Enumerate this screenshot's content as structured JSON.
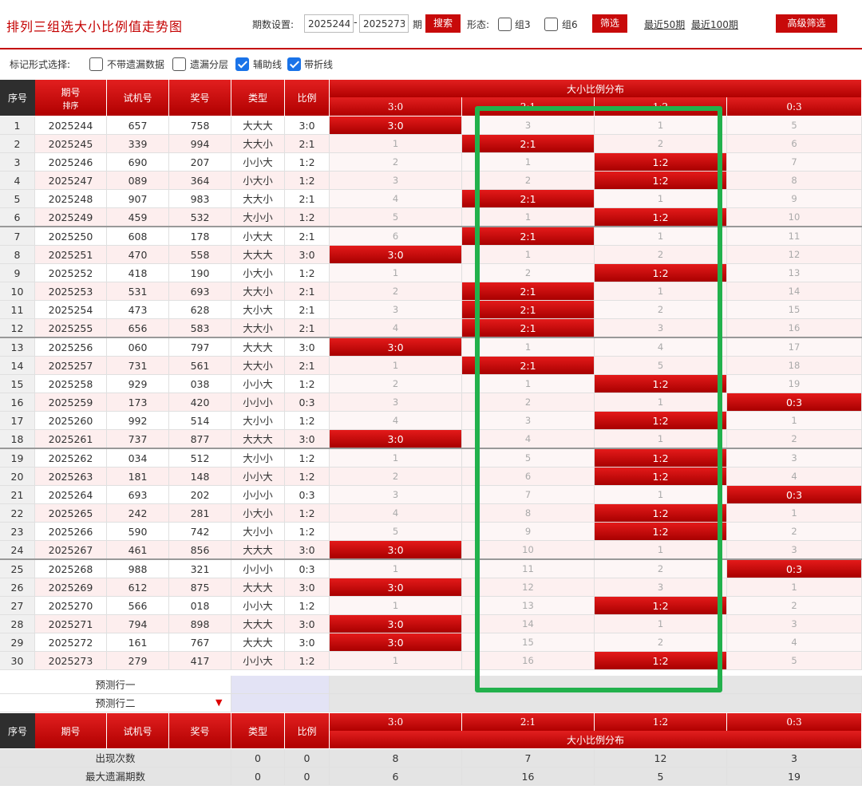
{
  "header": {
    "title": "排列三组选大小比例值走势图",
    "period_label": "期数设置:",
    "period_from": "2025244",
    "period_to": "2025273",
    "period_unit": "期",
    "search_label": "搜索",
    "form_label": "形态:",
    "zu3_label": "组3",
    "zu6_label": "组6",
    "filter_label": "筛选",
    "recent50": "最近50期",
    "recent100": "最近100期",
    "advanced_label": "高级筛选"
  },
  "markbar": {
    "label": "标记形式选择:",
    "opt1": "不带遗漏数据",
    "opt2": "遗漏分层",
    "opt3": "辅助线",
    "opt4": "带折线"
  },
  "table_headers": {
    "seq": "序号",
    "period": "期号",
    "sort": "排序",
    "trial": "试机号",
    "prize": "奖号",
    "type": "类型",
    "ratio": "比例",
    "dist": "大小比例分布",
    "cols": [
      "3:0",
      "2:1",
      "1:2",
      "0:3"
    ]
  },
  "rows": [
    {
      "seq": "1",
      "period": "2025244",
      "trial": "657",
      "prize": "758",
      "type": "大大大",
      "ratio": "3:0",
      "hit": 0,
      "miss": [
        "3:0",
        "3",
        "1",
        "5"
      ]
    },
    {
      "seq": "2",
      "period": "2025245",
      "trial": "339",
      "prize": "994",
      "type": "大大小",
      "ratio": "2:1",
      "hit": 1,
      "miss": [
        "1",
        "2:1",
        "2",
        "6"
      ]
    },
    {
      "seq": "3",
      "period": "2025246",
      "trial": "690",
      "prize": "207",
      "type": "小小大",
      "ratio": "1:2",
      "hit": 2,
      "miss": [
        "2",
        "1",
        "1:2",
        "7"
      ]
    },
    {
      "seq": "4",
      "period": "2025247",
      "trial": "089",
      "prize": "364",
      "type": "小大小",
      "ratio": "1:2",
      "hit": 2,
      "miss": [
        "3",
        "2",
        "1:2",
        "8"
      ]
    },
    {
      "seq": "5",
      "period": "2025248",
      "trial": "907",
      "prize": "983",
      "type": "大大小",
      "ratio": "2:1",
      "hit": 1,
      "miss": [
        "4",
        "2:1",
        "1",
        "9"
      ]
    },
    {
      "seq": "6",
      "period": "2025249",
      "trial": "459",
      "prize": "532",
      "type": "大小小",
      "ratio": "1:2",
      "hit": 2,
      "miss": [
        "5",
        "1",
        "1:2",
        "10"
      ]
    },
    {
      "seq": "7",
      "period": "2025250",
      "trial": "608",
      "prize": "178",
      "type": "小大大",
      "ratio": "2:1",
      "hit": 1,
      "miss": [
        "6",
        "2:1",
        "1",
        "11"
      ]
    },
    {
      "seq": "8",
      "period": "2025251",
      "trial": "470",
      "prize": "558",
      "type": "大大大",
      "ratio": "3:0",
      "hit": 0,
      "miss": [
        "3:0",
        "1",
        "2",
        "12"
      ]
    },
    {
      "seq": "9",
      "period": "2025252",
      "trial": "418",
      "prize": "190",
      "type": "小大小",
      "ratio": "1:2",
      "hit": 2,
      "miss": [
        "1",
        "2",
        "1:2",
        "13"
      ]
    },
    {
      "seq": "10",
      "period": "2025253",
      "trial": "531",
      "prize": "693",
      "type": "大大小",
      "ratio": "2:1",
      "hit": 1,
      "miss": [
        "2",
        "2:1",
        "1",
        "14"
      ]
    },
    {
      "seq": "11",
      "period": "2025254",
      "trial": "473",
      "prize": "628",
      "type": "大小大",
      "ratio": "2:1",
      "hit": 1,
      "miss": [
        "3",
        "2:1",
        "2",
        "15"
      ]
    },
    {
      "seq": "12",
      "period": "2025255",
      "trial": "656",
      "prize": "583",
      "type": "大大小",
      "ratio": "2:1",
      "hit": 1,
      "miss": [
        "4",
        "2:1",
        "3",
        "16"
      ]
    },
    {
      "seq": "13",
      "period": "2025256",
      "trial": "060",
      "prize": "797",
      "type": "大大大",
      "ratio": "3:0",
      "hit": 0,
      "miss": [
        "3:0",
        "1",
        "4",
        "17"
      ]
    },
    {
      "seq": "14",
      "period": "2025257",
      "trial": "731",
      "prize": "561",
      "type": "大大小",
      "ratio": "2:1",
      "hit": 1,
      "miss": [
        "1",
        "2:1",
        "5",
        "18"
      ]
    },
    {
      "seq": "15",
      "period": "2025258",
      "trial": "929",
      "prize": "038",
      "type": "小小大",
      "ratio": "1:2",
      "hit": 2,
      "miss": [
        "2",
        "1",
        "1:2",
        "19"
      ]
    },
    {
      "seq": "16",
      "period": "2025259",
      "trial": "173",
      "prize": "420",
      "type": "小小小",
      "ratio": "0:3",
      "hit": 3,
      "miss": [
        "3",
        "2",
        "1",
        "0:3"
      ]
    },
    {
      "seq": "17",
      "period": "2025260",
      "trial": "992",
      "prize": "514",
      "type": "大小小",
      "ratio": "1:2",
      "hit": 2,
      "miss": [
        "4",
        "3",
        "1:2",
        "1"
      ]
    },
    {
      "seq": "18",
      "period": "2025261",
      "trial": "737",
      "prize": "877",
      "type": "大大大",
      "ratio": "3:0",
      "hit": 0,
      "miss": [
        "3:0",
        "4",
        "1",
        "2"
      ]
    },
    {
      "seq": "19",
      "period": "2025262",
      "trial": "034",
      "prize": "512",
      "type": "大小小",
      "ratio": "1:2",
      "hit": 2,
      "miss": [
        "1",
        "5",
        "1:2",
        "3"
      ]
    },
    {
      "seq": "20",
      "period": "2025263",
      "trial": "181",
      "prize": "148",
      "type": "小小大",
      "ratio": "1:2",
      "hit": 2,
      "miss": [
        "2",
        "6",
        "1:2",
        "4"
      ]
    },
    {
      "seq": "21",
      "period": "2025264",
      "trial": "693",
      "prize": "202",
      "type": "小小小",
      "ratio": "0:3",
      "hit": 3,
      "miss": [
        "3",
        "7",
        "1",
        "0:3"
      ]
    },
    {
      "seq": "22",
      "period": "2025265",
      "trial": "242",
      "prize": "281",
      "type": "小大小",
      "ratio": "1:2",
      "hit": 2,
      "miss": [
        "4",
        "8",
        "1:2",
        "1"
      ]
    },
    {
      "seq": "23",
      "period": "2025266",
      "trial": "590",
      "prize": "742",
      "type": "大小小",
      "ratio": "1:2",
      "hit": 2,
      "miss": [
        "5",
        "9",
        "1:2",
        "2"
      ]
    },
    {
      "seq": "24",
      "period": "2025267",
      "trial": "461",
      "prize": "856",
      "type": "大大大",
      "ratio": "3:0",
      "hit": 0,
      "miss": [
        "3:0",
        "10",
        "1",
        "3"
      ]
    },
    {
      "seq": "25",
      "period": "2025268",
      "trial": "988",
      "prize": "321",
      "type": "小小小",
      "ratio": "0:3",
      "hit": 3,
      "miss": [
        "1",
        "11",
        "2",
        "0:3"
      ]
    },
    {
      "seq": "26",
      "period": "2025269",
      "trial": "612",
      "prize": "875",
      "type": "大大大",
      "ratio": "3:0",
      "hit": 0,
      "miss": [
        "3:0",
        "12",
        "3",
        "1"
      ]
    },
    {
      "seq": "27",
      "period": "2025270",
      "trial": "566",
      "prize": "018",
      "type": "小小大",
      "ratio": "1:2",
      "hit": 2,
      "miss": [
        "1",
        "13",
        "1:2",
        "2"
      ]
    },
    {
      "seq": "28",
      "period": "2025271",
      "trial": "794",
      "prize": "898",
      "type": "大大大",
      "ratio": "3:0",
      "hit": 0,
      "miss": [
        "3:0",
        "14",
        "1",
        "3"
      ]
    },
    {
      "seq": "29",
      "period": "2025272",
      "trial": "161",
      "prize": "767",
      "type": "大大大",
      "ratio": "3:0",
      "hit": 0,
      "miss": [
        "3:0",
        "15",
        "2",
        "4"
      ]
    },
    {
      "seq": "30",
      "period": "2025273",
      "trial": "279",
      "prize": "417",
      "type": "小小大",
      "ratio": "1:2",
      "hit": 2,
      "miss": [
        "1",
        "16",
        "1:2",
        "5"
      ]
    }
  ],
  "predict": {
    "row1": "预测行一",
    "row2": "预测行二"
  },
  "stats": [
    {
      "label": "出现次数",
      "type": "0",
      "ratio": "0",
      "vals": [
        "8",
        "7",
        "12",
        "3"
      ]
    },
    {
      "label": "最大遗漏期数",
      "type": "0",
      "ratio": "0",
      "vals": [
        "6",
        "16",
        "5",
        "19"
      ]
    }
  ],
  "colors": {
    "accent": "#c80a0a",
    "highlight": "#22b14c",
    "checkbox": "#1a73e8"
  }
}
